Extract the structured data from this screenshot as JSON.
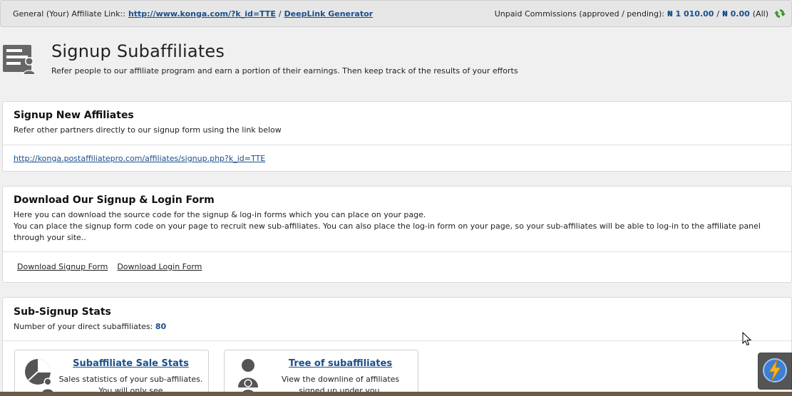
{
  "topbar": {
    "label": "General (Your) Affiliate Link::",
    "affiliate_link": "http://www.konga.com/?k_id=TTE",
    "divider": "/",
    "deeplink_label": "DeepLink Generator",
    "commissions_label": "Unpaid Commissions (approved / pending):",
    "approved": "₦ 1 010.00",
    "slash": "/",
    "pending": "₦ 0.00",
    "scope": "(All)"
  },
  "header": {
    "title": "Signup Subaffiliates",
    "subtitle": "Refer people to our affiliate program and earn a portion of their earnings. Then keep track of the results of your efforts"
  },
  "signup_panel": {
    "title": "Signup New Affiliates",
    "desc": "Refer other partners directly to our signup form using the link below",
    "link": "http://konga.postaffiliatepro.com/affiliates/signup.php?k_id=TTE"
  },
  "download_panel": {
    "title": "Download Our Signup & Login Form",
    "desc_line1": "Here you can download the source code for the signup & log-in forms which you can place on your page.",
    "desc_line2": "You can place the signup form code on your page to recruit new sub-affiliates. You can also place the log-in form on your page, so your sub-affiliates will be able to log-in to the affiliate panel through your site..",
    "signup_form_link": "Download Signup Form",
    "login_form_link": "Download Login Form"
  },
  "stats_panel": {
    "title": "Sub-Signup Stats",
    "count_label": "Number of your direct subaffiliates:",
    "count": "80",
    "cards": [
      {
        "title": "Subaffiliate Sale Stats",
        "text": "Sales statistics of your sub-affiliates. You will only see",
        "icon": "pie-chart-user-icon"
      },
      {
        "title": "Tree of subaffiliates",
        "text": "View the downline of affiliates signed up under you.",
        "icon": "user-tree-icon"
      }
    ]
  },
  "colors": {
    "link": "#1a4f8a",
    "panel_bg": "#ffffff",
    "page_bg": "#f0f0f0",
    "refresh_green": "#3a9a2a"
  }
}
